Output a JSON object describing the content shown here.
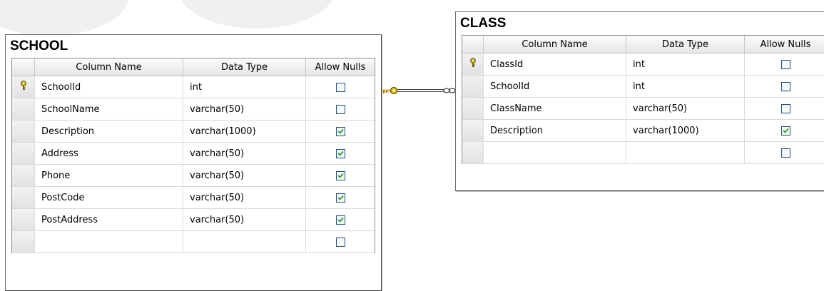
{
  "school": {
    "title": "SCHOOL",
    "headers": {
      "name": "Column Name",
      "type": "Data Type",
      "nulls": "Allow Nulls"
    },
    "rows": [
      {
        "key": true,
        "name": "SchoolId",
        "type": "int",
        "nulls": false
      },
      {
        "key": false,
        "name": "SchoolName",
        "type": "varchar(50)",
        "nulls": false
      },
      {
        "key": false,
        "name": "Description",
        "type": "varchar(1000)",
        "nulls": true
      },
      {
        "key": false,
        "name": "Address",
        "type": "varchar(50)",
        "nulls": true
      },
      {
        "key": false,
        "name": "Phone",
        "type": "varchar(50)",
        "nulls": true
      },
      {
        "key": false,
        "name": "PostCode",
        "type": "varchar(50)",
        "nulls": true
      },
      {
        "key": false,
        "name": "PostAddress",
        "type": "varchar(50)",
        "nulls": true
      },
      {
        "key": false,
        "name": "",
        "type": "",
        "nulls": false
      }
    ]
  },
  "class": {
    "title": "CLASS",
    "headers": {
      "name": "Column Name",
      "type": "Data Type",
      "nulls": "Allow Nulls"
    },
    "rows": [
      {
        "key": true,
        "name": "ClassId",
        "type": "int",
        "nulls": false
      },
      {
        "key": false,
        "name": "SchoolId",
        "type": "int",
        "nulls": false
      },
      {
        "key": false,
        "name": "ClassName",
        "type": "varchar(50)",
        "nulls": false
      },
      {
        "key": false,
        "name": "Description",
        "type": "varchar(1000)",
        "nulls": true
      },
      {
        "key": false,
        "name": "",
        "type": "",
        "nulls": false
      }
    ]
  },
  "relationship": {
    "from": "SCHOOL",
    "to": "CLASS",
    "from_end": "key-icon",
    "to_end": "infinity-icon"
  },
  "colors": {
    "check": "#21a121",
    "key": "#e8c01e",
    "checkbox_border": "#1c5180"
  }
}
